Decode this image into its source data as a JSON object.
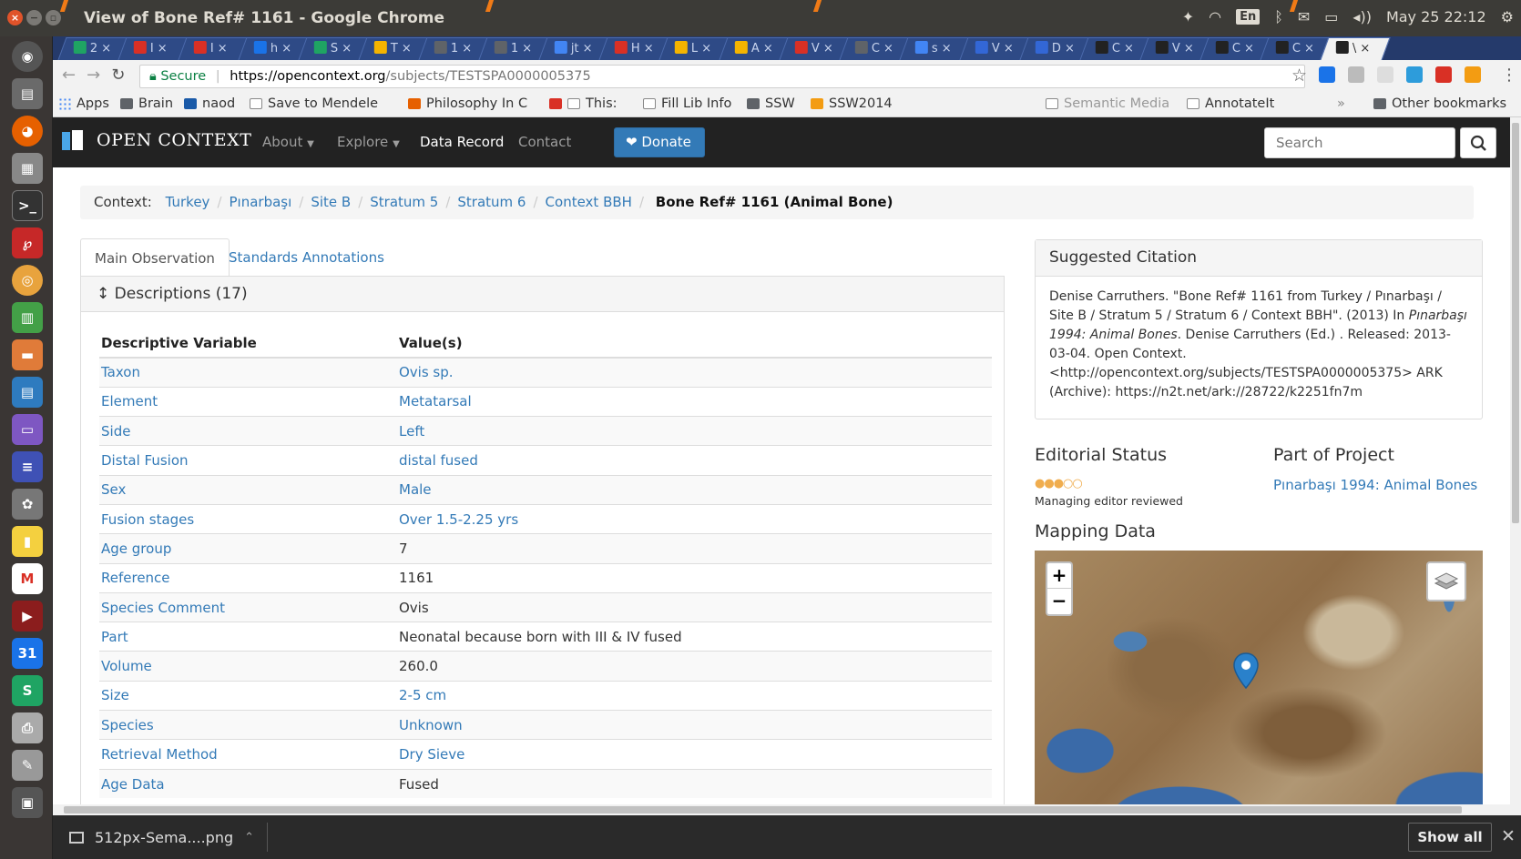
{
  "window": {
    "title": "View of Bone Ref# 1161 - Google Chrome"
  },
  "tray": {
    "lang": "En",
    "datetime": "May 25 22:12"
  },
  "tabs": [
    {
      "label": "2",
      "color": "#1fa463"
    },
    {
      "label": "I",
      "color": "#d93025"
    },
    {
      "label": "I",
      "color": "#d93025"
    },
    {
      "label": "h",
      "color": "#1a73e8"
    },
    {
      "label": "S",
      "color": "#1fa463"
    },
    {
      "label": "T",
      "color": "#f4b400"
    },
    {
      "label": "1",
      "color": "#5f6368"
    },
    {
      "label": "1",
      "color": "#5f6368"
    },
    {
      "label": "jt",
      "color": "#4285f4"
    },
    {
      "label": "H",
      "color": "#d93025"
    },
    {
      "label": "L",
      "color": "#f4b400"
    },
    {
      "label": "A",
      "color": "#f4b400"
    },
    {
      "label": "V",
      "color": "#d93025"
    },
    {
      "label": "C",
      "color": "#5f6368"
    },
    {
      "label": "s",
      "color": "#4285f4"
    },
    {
      "label": "V",
      "color": "#3367d6"
    },
    {
      "label": "D",
      "color": "#3367d6"
    },
    {
      "label": "C",
      "color": "#222222"
    },
    {
      "label": "V",
      "color": "#222222"
    },
    {
      "label": "C",
      "color": "#222222"
    },
    {
      "label": "C",
      "color": "#222222"
    },
    {
      "label": "\\",
      "color": "#222222"
    }
  ],
  "omnibox": {
    "secure_label": "Secure",
    "url_host": "https://opencontext.org",
    "url_path": "/subjects/TESTSPA0000005375"
  },
  "bookmarks": [
    "Apps",
    "Brain",
    "naod",
    "Save to Mendele",
    "Philosophy In C",
    "This:",
    "Fill Lib Info",
    "SSW",
    "SSW2014",
    "Semantic Media",
    "AnnotateIt",
    "Other bookmarks"
  ],
  "site_nav": {
    "brand": "OPEN CONTEXT",
    "about": "About",
    "explore": "Explore",
    "data_record": "Data Record",
    "contact": "Contact",
    "donate": "Donate",
    "search_placeholder": "Search"
  },
  "breadcrumb": {
    "label": "Context:",
    "items": [
      "Turkey",
      "Pınarbaşı",
      "Site B",
      "Stratum 5",
      "Stratum 6",
      "Context BBH"
    ],
    "current": "Bone Ref# 1161 (Animal Bone)"
  },
  "obs_tabs": {
    "main": "Main Observation",
    "standards": "Standards Annotations"
  },
  "descriptions": {
    "heading": "Descriptions (17)",
    "col_var": "Descriptive Variable",
    "col_val": "Value(s)",
    "rows": [
      {
        "var": "Taxon",
        "val": "Ovis sp.",
        "link": true
      },
      {
        "var": "Element",
        "val": "Metatarsal",
        "link": true
      },
      {
        "var": "Side",
        "val": "Left",
        "link": true
      },
      {
        "var": "Distal Fusion",
        "val": "distal fused",
        "link": true
      },
      {
        "var": "Sex",
        "val": "Male",
        "link": true
      },
      {
        "var": "Fusion stages",
        "val": "Over 1.5-2.25 yrs",
        "link": true
      },
      {
        "var": "Age group",
        "val": "7",
        "link": false
      },
      {
        "var": "Reference",
        "val": "1161",
        "link": false
      },
      {
        "var": "Species Comment",
        "val": "Ovis",
        "link": false
      },
      {
        "var": "Part",
        "val": "Neonatal because born with III & IV fused",
        "link": false
      },
      {
        "var": "Volume",
        "val": "260.0",
        "link": false
      },
      {
        "var": "Size",
        "val": "2-5 cm",
        "link": true
      },
      {
        "var": "Species",
        "val": "Unknown",
        "link": true
      },
      {
        "var": "Retrieval Method",
        "val": "Dry Sieve",
        "link": true
      },
      {
        "var": "Age Data",
        "val": "Fused",
        "link": false
      }
    ]
  },
  "citation": {
    "heading": "Suggested Citation",
    "text_1": "Denise Carruthers. \"Bone Ref# 1161 from Turkey / Pınarbaşı / Site B / Stratum 5 / Stratum 6 / Context BBH\". (2013) In ",
    "italic": "Pınarbaşı 1994: Animal Bones",
    "text_2": ". Denise Carruthers (Ed.) . Released: 2013-03-04. Open Context. <http://opencontext.org/subjects/TESTSPA0000005375> ARK (Archive): https://n2t.net/ark://28722/k2251fn7m"
  },
  "editorial": {
    "label": "Editorial Status",
    "stars_filled": 3,
    "stars_total": 5,
    "status": "Managing editor reviewed"
  },
  "project": {
    "label": "Part of Project",
    "link": "Pınarbaşı 1994: Animal Bones"
  },
  "mapping": {
    "label": "Mapping Data",
    "zoom_in": "+",
    "zoom_out": "−"
  },
  "downloads": {
    "file": "512px-Sema....png",
    "show_all": "Show all"
  }
}
